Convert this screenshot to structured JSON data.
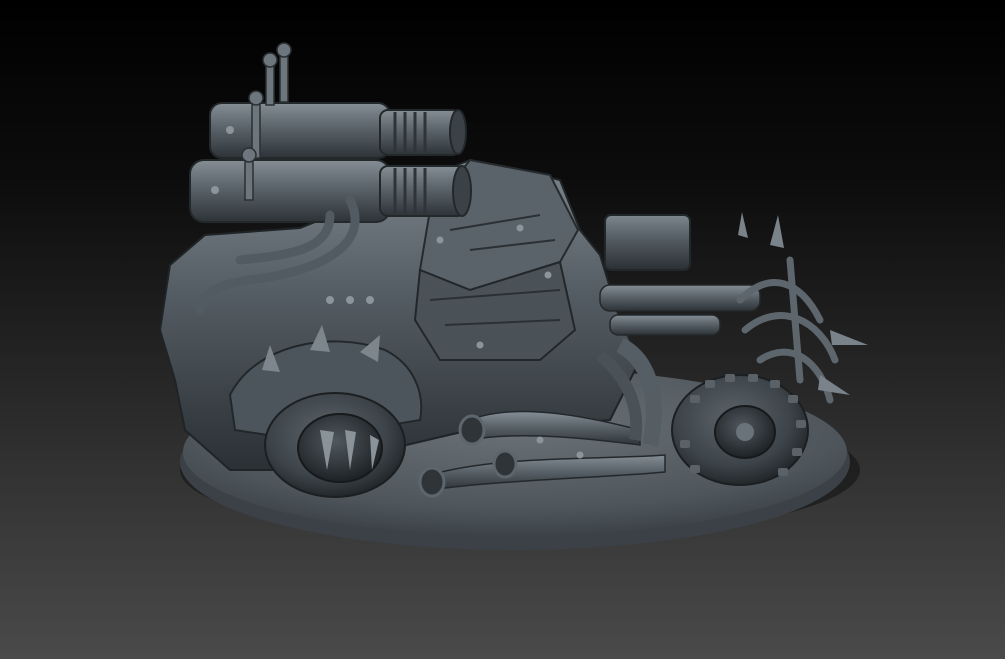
{
  "scene": {
    "subject": "sculpted-vehicle-model-render",
    "background_top": "#000000",
    "background_bottom": "#4a4a4a",
    "material_color": "#4d555c",
    "material_highlight": "#7c858c",
    "material_shadow": "#23282c",
    "base_color": "#5a6268"
  }
}
